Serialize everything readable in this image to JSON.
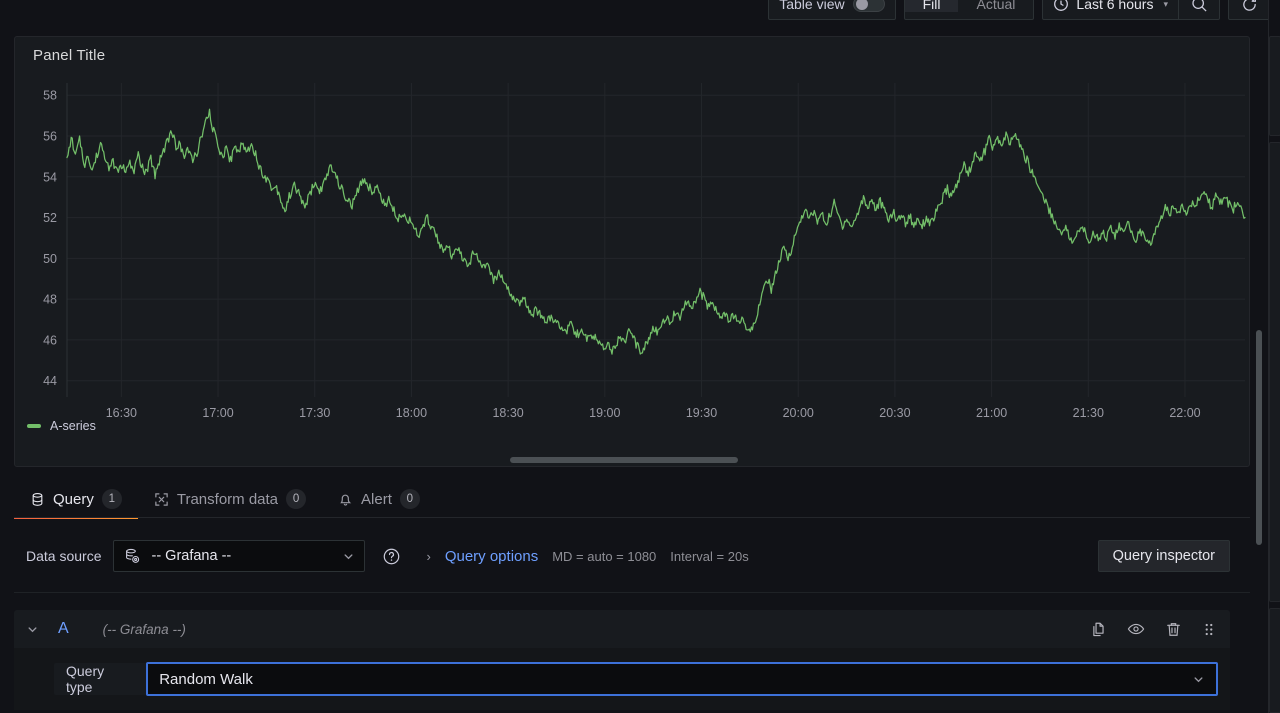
{
  "toolbar": {
    "table_view_label": "Table view",
    "table_view_on": false,
    "fit_buttons": [
      {
        "label": "Fill",
        "active": true
      },
      {
        "label": "Actual",
        "active": false
      }
    ],
    "time_range_label": "Last 6 hours",
    "clock_icon": "clock-icon",
    "zoom_out_icon": "search-minus-icon",
    "refresh_icon": "refresh-icon",
    "caret_glyph": "▾"
  },
  "panel": {
    "title": "Panel Title",
    "legend": [
      {
        "label": "A-series",
        "color": "#73bf69"
      }
    ]
  },
  "tabs": [
    {
      "label": "Query",
      "badge": "1",
      "icon": "database-icon",
      "active": true
    },
    {
      "label": "Transform data",
      "badge": "0",
      "icon": "transform-icon",
      "active": false
    },
    {
      "label": "Alert",
      "badge": "0",
      "icon": "bell-icon",
      "active": false
    }
  ],
  "datasource_row": {
    "label": "Data source",
    "selected": "-- Grafana --",
    "select_icon": "grafana-datasource-icon",
    "caret_glyph": "⌄",
    "help_icon": "question-circle-icon",
    "query_options": {
      "chevron_glyph": "›",
      "title": "Query options",
      "max_data_points": "MD = auto = 1080",
      "interval": "Interval = 20s"
    },
    "query_inspector_label": "Query inspector"
  },
  "query_row": {
    "chevron_glyph": "⌄",
    "ref_id": "A",
    "datasource": "(-- Grafana --)",
    "actions": [
      {
        "name": "duplicate-query-icon",
        "title": "Duplicate query"
      },
      {
        "name": "hide-response-icon",
        "title": "Hide response"
      },
      {
        "name": "remove-query-icon",
        "title": "Remove query"
      },
      {
        "name": "drag-handle-icon",
        "title": "Drag to reorder"
      }
    ],
    "query_type_label": "Query type",
    "query_type_value": "Random Walk",
    "query_type_caret": "⌄"
  },
  "colors": {
    "accent_orange": "#f55f3e",
    "link_blue": "#6e9fff",
    "focus_blue": "#3d71d9",
    "series_green": "#73bf69",
    "panel_bg": "#181b1f",
    "app_bg": "#111217"
  },
  "chart_data": {
    "type": "line",
    "title": "Panel Title",
    "xlabel": "",
    "ylabel": "",
    "grid": true,
    "legend_position": "bottom-left",
    "series": [
      {
        "name": "A-series",
        "color": "#73bf69",
        "values": [
          54.9,
          55.9,
          55.2,
          55.8,
          54.6,
          54.9,
          54.3,
          55.0,
          55.6,
          54.9,
          54.5,
          54.7,
          54.2,
          54.6,
          54.2,
          54.6,
          54.3,
          55.1,
          54.4,
          54.2,
          54.9,
          54.1,
          54.8,
          55.3,
          55.8,
          56.3,
          55.4,
          55.6,
          55.0,
          55.3,
          54.8,
          55.2,
          55.9,
          56.6,
          57.1,
          56.2,
          55.6,
          55.0,
          55.4,
          54.8,
          55.5,
          55.3,
          55.6,
          55.2,
          55.7,
          55.1,
          54.4,
          54.1,
          53.8,
          53.4,
          53.5,
          52.9,
          52.3,
          53.0,
          53.6,
          53.3,
          52.8,
          52.6,
          53.2,
          53.7,
          53.3,
          53.5,
          54.0,
          54.6,
          54.1,
          53.6,
          53.2,
          52.8,
          52.6,
          53.1,
          53.6,
          53.9,
          53.5,
          53.3,
          53.5,
          53.0,
          52.6,
          52.9,
          52.4,
          52.0,
          52.3,
          51.8,
          52.0,
          51.4,
          51.0,
          51.6,
          52.0,
          51.5,
          51.2,
          50.7,
          50.3,
          50.5,
          50.0,
          50.5,
          50.1,
          49.9,
          49.6,
          50.4,
          49.9,
          49.5,
          49.8,
          49.2,
          48.9,
          49.3,
          49.0,
          48.6,
          48.2,
          48.0,
          47.7,
          48.0,
          47.6,
          47.3,
          47.5,
          47.2,
          46.9,
          47.2,
          46.8,
          47.0,
          46.6,
          46.4,
          46.8,
          46.5,
          46.2,
          46.4,
          46.0,
          46.3,
          46.1,
          45.9,
          45.6,
          45.9,
          45.5,
          45.8,
          46.2,
          45.9,
          46.4,
          46.1,
          45.7,
          45.4,
          45.8,
          46.2,
          46.6,
          46.3,
          46.8,
          47.2,
          46.9,
          47.4,
          47.0,
          47.6,
          48.0,
          47.5,
          47.9,
          48.4,
          48.0,
          47.6,
          47.9,
          47.4,
          47.0,
          47.3,
          46.9,
          47.2,
          46.8,
          47.1,
          46.7,
          46.3,
          46.9,
          47.6,
          48.3,
          49.0,
          48.5,
          49.2,
          49.9,
          50.5,
          50.0,
          50.6,
          51.3,
          51.9,
          52.4,
          51.9,
          52.3,
          51.8,
          52.2,
          51.7,
          52.1,
          52.7,
          52.1,
          51.6,
          52.0,
          51.5,
          51.9,
          52.4,
          53.0,
          52.5,
          52.9,
          52.4,
          52.8,
          52.3,
          51.9,
          52.3,
          51.8,
          52.2,
          51.7,
          52.1,
          51.6,
          52.0,
          51.6,
          52.0,
          51.7,
          52.1,
          52.5,
          53.0,
          53.4,
          53.0,
          53.5,
          54.0,
          54.6,
          54.2,
          54.7,
          55.2,
          54.8,
          55.3,
          55.9,
          55.4,
          55.9,
          55.5,
          56.0,
          55.6,
          56.1,
          55.7,
          55.2,
          54.8,
          54.3,
          53.9,
          53.4,
          53.0,
          52.5,
          52.1,
          51.6,
          51.2,
          51.6,
          51.1,
          50.7,
          51.2,
          51.6,
          51.2,
          50.8,
          51.3,
          50.9,
          51.4,
          51.0,
          51.5,
          51.1,
          51.6,
          51.2,
          51.7,
          51.3,
          50.9,
          51.4,
          51.0,
          50.6,
          51.0,
          51.5,
          52.0,
          52.5,
          52.1,
          52.6,
          52.2,
          52.7,
          52.3,
          52.8,
          52.4,
          52.9,
          53.3,
          52.9,
          52.5,
          53.0,
          52.6,
          53.1,
          52.7,
          52.3,
          52.8,
          52.4,
          52.0
        ]
      }
    ],
    "x_ticks": [
      "16:30",
      "17:00",
      "17:30",
      "18:00",
      "18:30",
      "19:00",
      "19:30",
      "20:00",
      "20:30",
      "21:00",
      "21:30",
      "22:00"
    ],
    "y_ticks": [
      44,
      46,
      48,
      50,
      52,
      54,
      56,
      58
    ],
    "ylim": [
      43.2,
      58.6
    ],
    "xlim": [
      "16:22",
      "22:22"
    ]
  }
}
